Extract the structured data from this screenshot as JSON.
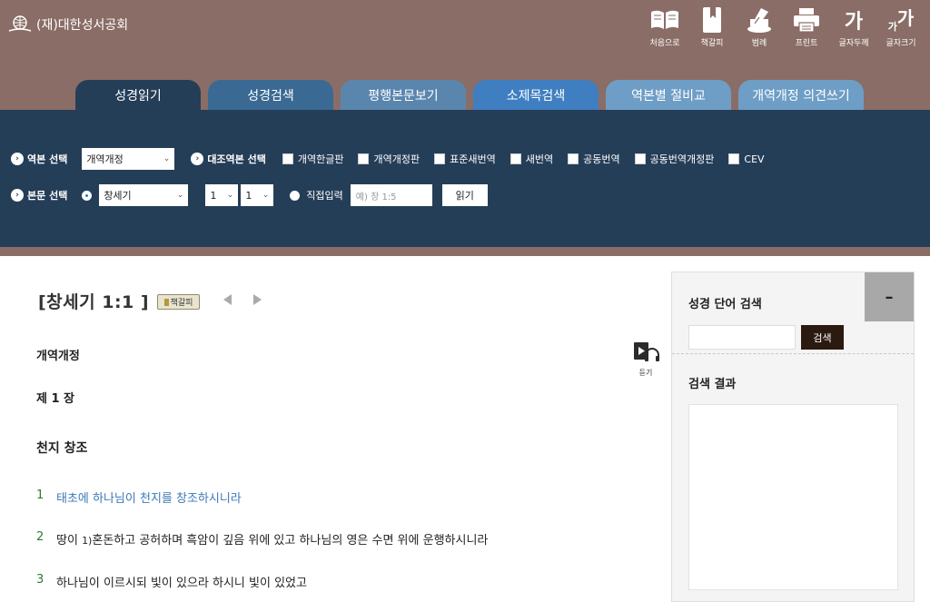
{
  "header": {
    "logo_text": "(재)대한성서공회",
    "tools": [
      {
        "icon": "book-open-icon",
        "label": "처음으로"
      },
      {
        "icon": "bookmark-book-icon",
        "label": "책갈피"
      },
      {
        "icon": "memo-pen-icon",
        "label": "범례"
      },
      {
        "icon": "printer-icon",
        "label": "프린트"
      },
      {
        "icon": "font-thick-icon",
        "glyph": "가",
        "label": "글자두께"
      },
      {
        "icon": "font-size-icon",
        "glyph": "가",
        "label": "글자크기"
      }
    ]
  },
  "tabs": [
    "성경읽기",
    "성경검색",
    "평행본문보기",
    "소제목검색",
    "역본별 절비교",
    "개역개정 의견쓰기"
  ],
  "selector": {
    "version_label": "역본 선택",
    "version_value": "개역개정",
    "compare_label": "대조역본 선택",
    "compare_options": [
      "개역한글판",
      "개역개정판",
      "표준새번역",
      "새번역",
      "공동번역",
      "공동번역개정판",
      "CEV"
    ],
    "passage_label": "본문 선택",
    "book_value": "창세기",
    "chapter_value": "1",
    "verse_value": "1",
    "direct_label": "직접입력",
    "direct_placeholder": "예) 창 1:5",
    "read_button": "읽기"
  },
  "content": {
    "reference": "[창세기 1:1 ]",
    "bookmark_label": "책갈피",
    "version": "개역개정",
    "listen_label": "듣기",
    "chapter": "제 1 장",
    "heading": "천지 창조",
    "verses": [
      {
        "num": "1",
        "text": "태초에 하나님이 천지를 창조하시니라"
      },
      {
        "num": "2",
        "pre": "땅이 ",
        "footnote": "1)",
        "text": "혼돈하고 공허하며 흑암이 깊음 위에 있고 하나님의 영은 수면 위에 운행하시니라"
      },
      {
        "num": "3",
        "text": "하나님이 이르시되 빛이 있으라 하시니 빛이 있었고"
      }
    ]
  },
  "sidebar": {
    "title": "성경 단어 검색",
    "collapse_symbol": "–",
    "search_value": "",
    "search_button": "검색",
    "results_title": "검색 결과"
  }
}
